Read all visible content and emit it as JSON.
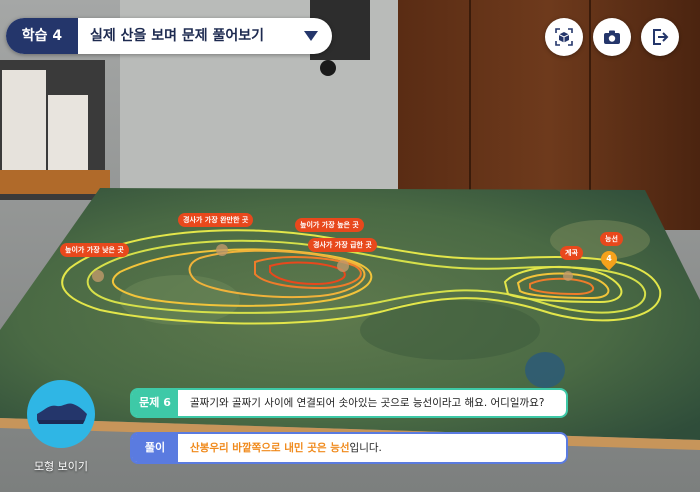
{
  "header": {
    "lesson_badge": "학습 4",
    "lesson_title": "실제 산을 보며 문제 풀어보기",
    "dropdown_icon": "chevron-down-icon"
  },
  "toolbar": {
    "buttons": [
      {
        "icon": "ar-cube-icon"
      },
      {
        "icon": "camera-icon"
      },
      {
        "icon": "exit-icon"
      }
    ]
  },
  "map": {
    "labels": [
      "높이가 가장 낮은 곳",
      "경사가 가장 완만한 곳",
      "높이가 가장 높은 곳",
      "경사가 가장 급한 곳",
      "계곡",
      "능선"
    ],
    "marker_number": "4"
  },
  "model_button": {
    "label": "모형 보이기",
    "icon": "mountain-model-icon"
  },
  "question": {
    "label": "문제 6",
    "text": "골짜기와 골짜기 사이에 연결되어 솟아있는 곳으로 능선이라고 해요. 어디일까요?"
  },
  "answer": {
    "label": "풀이",
    "highlight": "산봉우리 바깥쪽으로 내민 곳은 능선",
    "suffix": "입니다."
  },
  "colors": {
    "navy": "#24366b",
    "teal": "#3ec9a7",
    "blue": "#5a7be0",
    "orange": "#e8481c",
    "sky": "#2fb6e5"
  }
}
